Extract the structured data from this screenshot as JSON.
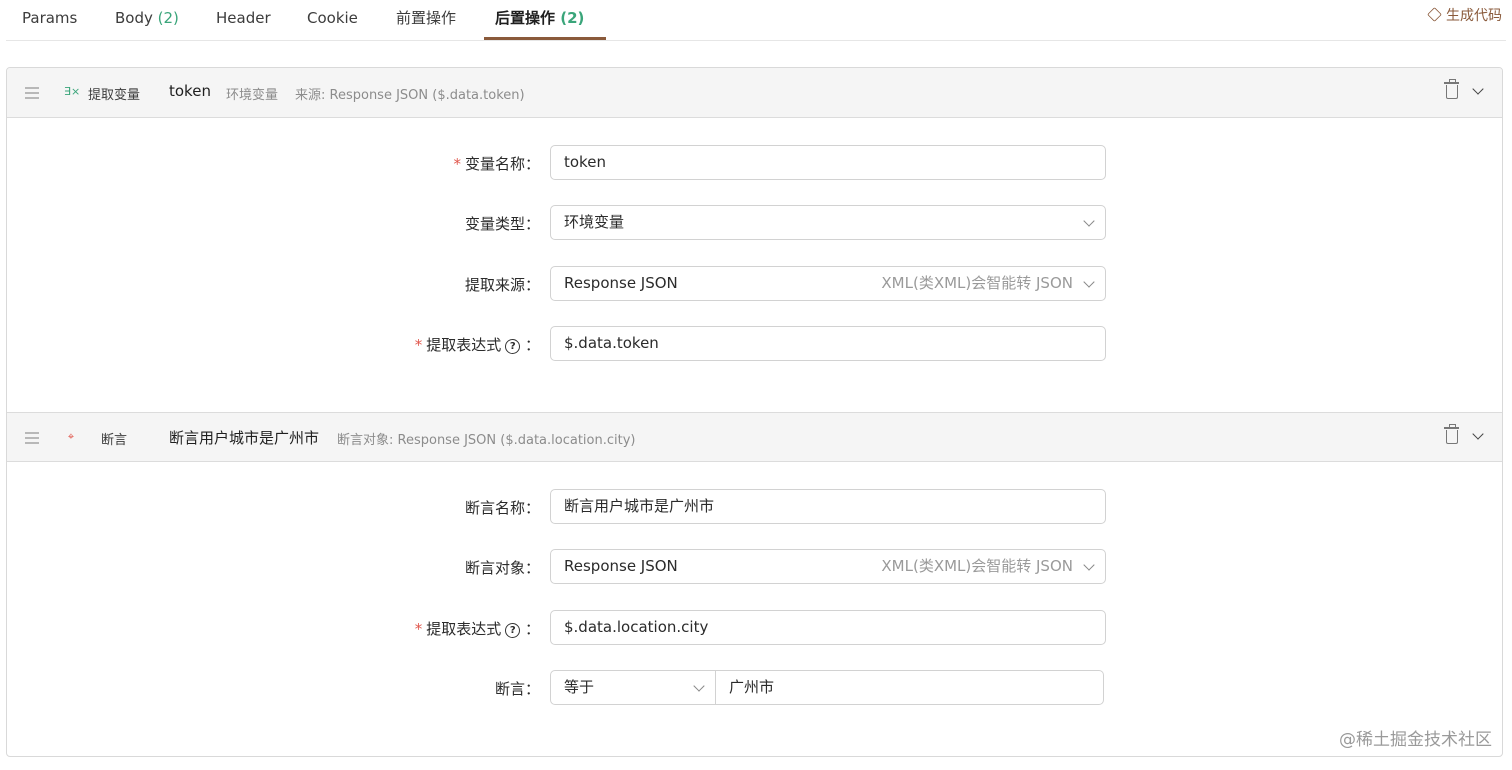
{
  "tabs": [
    {
      "label": "Params",
      "count": ""
    },
    {
      "label": "Body",
      "count": "(2)"
    },
    {
      "label": "Header",
      "count": ""
    },
    {
      "label": "Cookie",
      "count": ""
    },
    {
      "label": "前置操作",
      "count": ""
    },
    {
      "label": "后置操作",
      "count": "(2)",
      "active": true
    }
  ],
  "generate_code_label": "生成代码",
  "extract": {
    "type_label": "提取变量",
    "name": "token",
    "scope": "环境变量",
    "source_summary": "来源: Response JSON ($.data.token)",
    "form": {
      "var_name_label": "变量名称",
      "var_name_value": "token",
      "var_type_label": "变量类型",
      "var_type_value": "环境变量",
      "source_label": "提取来源",
      "source_value": "Response JSON",
      "source_hint": "XML(类XML)会智能转 JSON",
      "expr_label": "提取表达式",
      "expr_value": "$.data.token"
    }
  },
  "assert": {
    "type_label": "断言",
    "name": "断言用户城市是广州市",
    "target_summary": "断言对象: Response JSON ($.data.location.city)",
    "form": {
      "name_label": "断言名称",
      "name_value": "断言用户城市是广州市",
      "target_label": "断言对象",
      "target_value": "Response JSON",
      "target_hint": "XML(类XML)会智能转 JSON",
      "expr_label": "提取表达式",
      "expr_value": "$.data.location.city",
      "assert_label": "断言",
      "operator_value": "等于",
      "expected_value": "广州市"
    }
  },
  "watermark": "@稀土掘金技术社区",
  "colors": {
    "accent": "#8a5a3b",
    "count": "#3aa57a",
    "required": "#e0564c"
  }
}
